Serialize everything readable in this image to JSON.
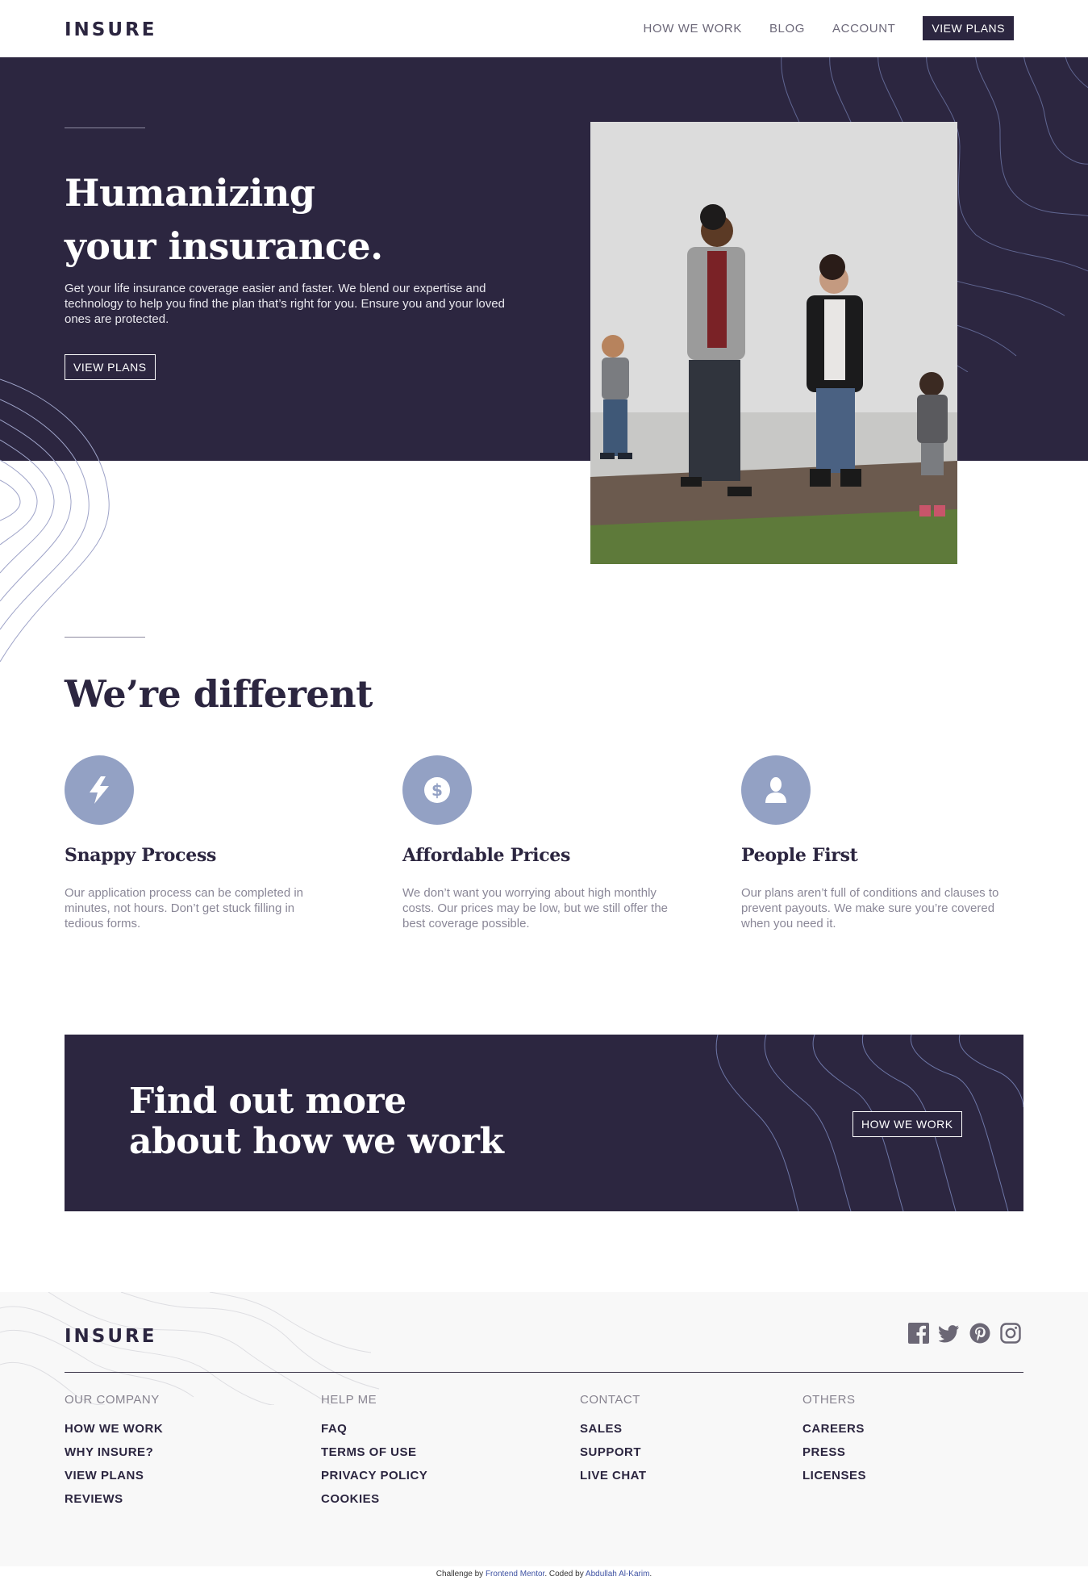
{
  "header": {
    "logo": "INSURE",
    "nav": [
      {
        "label": "HOW WE WORK"
      },
      {
        "label": "BLOG"
      },
      {
        "label": "ACCOUNT"
      }
    ],
    "cta_label": "VIEW PLANS"
  },
  "hero": {
    "title_line1": "Humanizing",
    "title_line2": "your insurance.",
    "text": "Get your life insurance coverage easier and faster. We blend our expertise and technology to help you find the plan that’s right for you. Ensure you and your loved ones are protected.",
    "button": "VIEW PLANS"
  },
  "different": {
    "title": "We’re different",
    "features": [
      {
        "icon": "snappy-process-icon",
        "title": "Snappy Process",
        "text": "Our application process can be completed in minutes, not hours. Don’t get stuck filling in tedious forms."
      },
      {
        "icon": "affordable-prices-icon",
        "title": "Affordable Prices",
        "text": "We don’t want you worrying about high monthly costs. Our prices may be low, but we still offer the best coverage possible."
      },
      {
        "icon": "people-first-icon",
        "title": "People First",
        "text": "Our plans aren’t full of conditions and clauses to prevent payouts. We make sure you’re covered when you need it."
      }
    ]
  },
  "cta": {
    "title_line1": "Find out more",
    "title_line2": "about how we work",
    "button": "HOW WE WORK"
  },
  "footer": {
    "logo": "INSURE",
    "socials": [
      "facebook-icon",
      "twitter-icon",
      "pinterest-icon",
      "instagram-icon"
    ],
    "columns": [
      {
        "heading": "OUR COMPANY",
        "links": [
          "HOW WE WORK",
          "WHY INSURE?",
          "VIEW PLANS",
          "REVIEWS"
        ]
      },
      {
        "heading": "HELP ME",
        "links": [
          "FAQ",
          "TERMS OF USE",
          "PRIVACY POLICY",
          "COOKIES"
        ]
      },
      {
        "heading": "CONTACT",
        "links": [
          "SALES",
          "SUPPORT",
          "LIVE CHAT"
        ]
      },
      {
        "heading": "OTHERS",
        "links": [
          "CAREERS",
          "PRESS",
          "LICENSES"
        ]
      }
    ]
  },
  "attribution": {
    "prefix": "Challenge by ",
    "challenge_link": "Frontend Mentor",
    "middle": ". Coded by ",
    "author_link": "Abdullah Al-Karim",
    "suffix": "."
  },
  "colors": {
    "dark_violet": "#2c2640",
    "accent_blue": "#93a1c4",
    "grey_text": "#8a8797"
  }
}
